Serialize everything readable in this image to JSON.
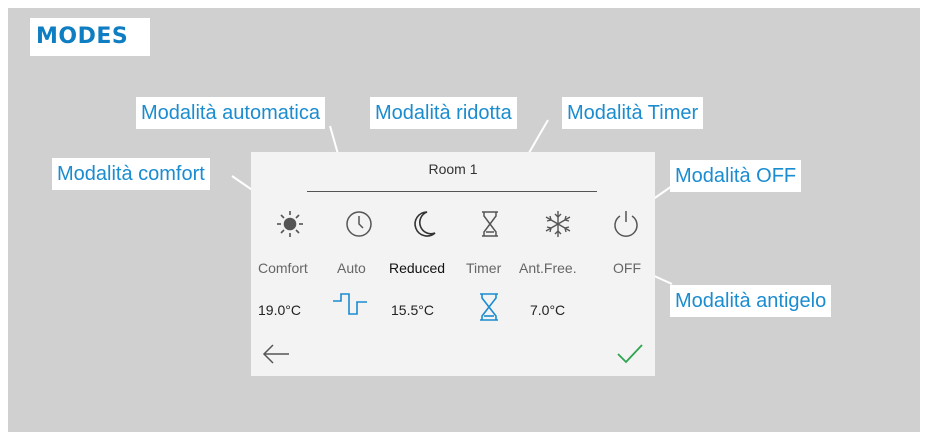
{
  "title": "MODES",
  "callouts": {
    "comfort": "Modalità comfort",
    "auto": "Modalità automatica",
    "reduced": "Modalità ridotta",
    "timer": "Modalità Timer",
    "off": "Modalità OFF",
    "antifreeze": "Modalità antigelo"
  },
  "screen": {
    "room": "Room 1",
    "modes": [
      {
        "label": "Comfort",
        "icon": "sun-icon"
      },
      {
        "label": "Auto",
        "icon": "clock-icon"
      },
      {
        "label": "Reduced",
        "icon": "moon-icon",
        "active": true
      },
      {
        "label": "Timer",
        "icon": "hourglass-icon"
      },
      {
        "label": "Ant.Free.",
        "icon": "snowflake-icon"
      },
      {
        "label": "OFF",
        "icon": "power-icon"
      }
    ],
    "temps": {
      "comfort": "19.0°C",
      "reduced": "15.5°C",
      "antifreeze": "7.0°C"
    },
    "icons": {
      "auto_indicator": "schedule-wave-icon",
      "timer_indicator": "hourglass-icon",
      "back": "back-arrow-icon",
      "confirm": "checkmark-icon"
    }
  },
  "colors": {
    "brand_blue": "#0f7dc2",
    "callout_text": "#1a8ccf",
    "background": "#d0d0d1",
    "check_green": "#2ea44f"
  }
}
